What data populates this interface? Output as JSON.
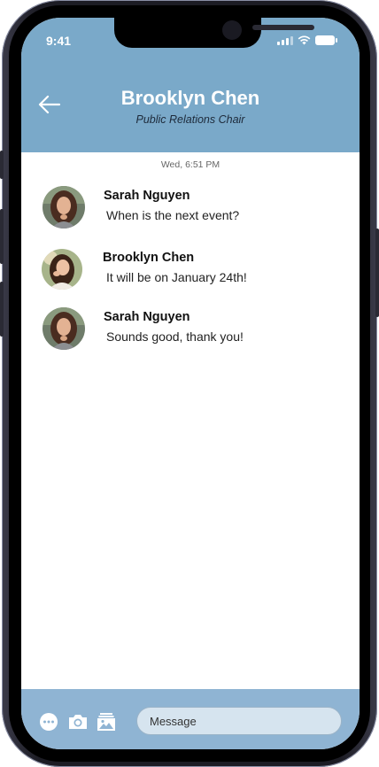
{
  "status_bar": {
    "time": "9:41"
  },
  "header": {
    "title": "Brooklyn Chen",
    "subtitle": "Public Relations Chair",
    "back_icon": "arrow-left-icon"
  },
  "conversation": {
    "timestamp": "Wed, 6:51 PM",
    "messages": [
      {
        "sender": "Sarah Nguyen",
        "text": "When is the next event?",
        "avatar": "sarah"
      },
      {
        "sender": "Brooklyn Chen",
        "text": "It will be on January 24th!",
        "avatar": "brooklyn"
      },
      {
        "sender": "Sarah Nguyen",
        "text": "Sounds good, thank you!",
        "avatar": "sarah"
      }
    ]
  },
  "composer": {
    "placeholder": "Message",
    "icons": [
      "more-icon",
      "camera-icon",
      "gallery-icon"
    ]
  },
  "colors": {
    "header_bg": "#7aa9c9",
    "composer_bg": "#8fb4d3",
    "input_bg": "#d6e4ef"
  }
}
